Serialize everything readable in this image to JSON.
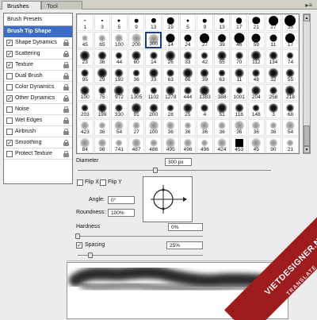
{
  "tabs": [
    {
      "label": "Brushes",
      "active": true
    },
    {
      "label": "Tool Presets",
      "active": false
    }
  ],
  "left_panel": {
    "brush_presets": "Brush Presets",
    "brush_tip_shape": "Brush Tip Shape",
    "options": [
      {
        "label": "Shape Dynamics",
        "checked": true
      },
      {
        "label": "Scattering",
        "checked": true
      },
      {
        "label": "Texture",
        "checked": true
      },
      {
        "label": "Dual Brush",
        "checked": false
      },
      {
        "label": "Color Dynamics",
        "checked": false
      },
      {
        "label": "Other Dynamics",
        "checked": true
      },
      {
        "label": "Noise",
        "checked": false
      },
      {
        "label": "Wet Edges",
        "checked": false
      },
      {
        "label": "Airbrush",
        "checked": false
      },
      {
        "label": "Smoothing",
        "checked": true
      },
      {
        "label": "Protect Texture",
        "checked": false
      }
    ]
  },
  "brush_grid": {
    "rows": [
      [
        "1",
        "3",
        "5",
        "9",
        "13",
        "19",
        "5",
        "9",
        "13",
        "17",
        "21",
        "27",
        "35"
      ],
      [
        "45",
        "65",
        "100",
        "200",
        "300",
        "14",
        "24",
        "27",
        "39",
        "46",
        "59",
        "11",
        "17"
      ],
      [
        "23",
        "36",
        "44",
        "60",
        "14",
        "26",
        "33",
        "42",
        "55",
        "70",
        "112",
        "134",
        "74"
      ],
      [
        "95",
        "29",
        "192",
        "36",
        "33",
        "63",
        "66",
        "39",
        "63",
        "11",
        "48",
        "32",
        "55"
      ],
      [
        "100",
        "75",
        "972",
        "1305",
        "1102",
        "1278",
        "444",
        "1383",
        "388",
        "1001",
        "204",
        "258",
        "218"
      ],
      [
        "203",
        "199",
        "330",
        "91",
        "200",
        "28",
        "25",
        "4",
        "51",
        "118",
        "148",
        "3",
        "68"
      ],
      [
        "423",
        "36",
        "54",
        "27",
        "100",
        "36",
        "36",
        "36",
        "36",
        "36",
        "36",
        "36",
        "54"
      ],
      [
        "84",
        "98",
        "741",
        "487",
        "486",
        "495",
        "496",
        "496",
        "424",
        "453",
        "45",
        "90",
        "21"
      ]
    ],
    "selected": "300"
  },
  "diameter": {
    "label": "Diameter",
    "value": "300 px",
    "fraction": 0.4
  },
  "flip_x": {
    "label": "Flip X",
    "checked": false
  },
  "flip_y": {
    "label": "Flip Y",
    "checked": false
  },
  "angle": {
    "label": "Angle:",
    "value": "0°"
  },
  "roundness": {
    "label": "Roundness:",
    "value": "100%"
  },
  "hardness": {
    "label": "Hardness",
    "value": "0%",
    "fraction": 0.0
  },
  "spacing": {
    "label": "Spacing",
    "value": "25%",
    "checked": true,
    "fraction": 0.1
  },
  "watermark": {
    "brand": "VIETDESIGNER.NET",
    "sub": "TRANSLATE"
  },
  "colors": {
    "selected": "#3a6cc9",
    "ribbon": "#9e1b1e"
  }
}
